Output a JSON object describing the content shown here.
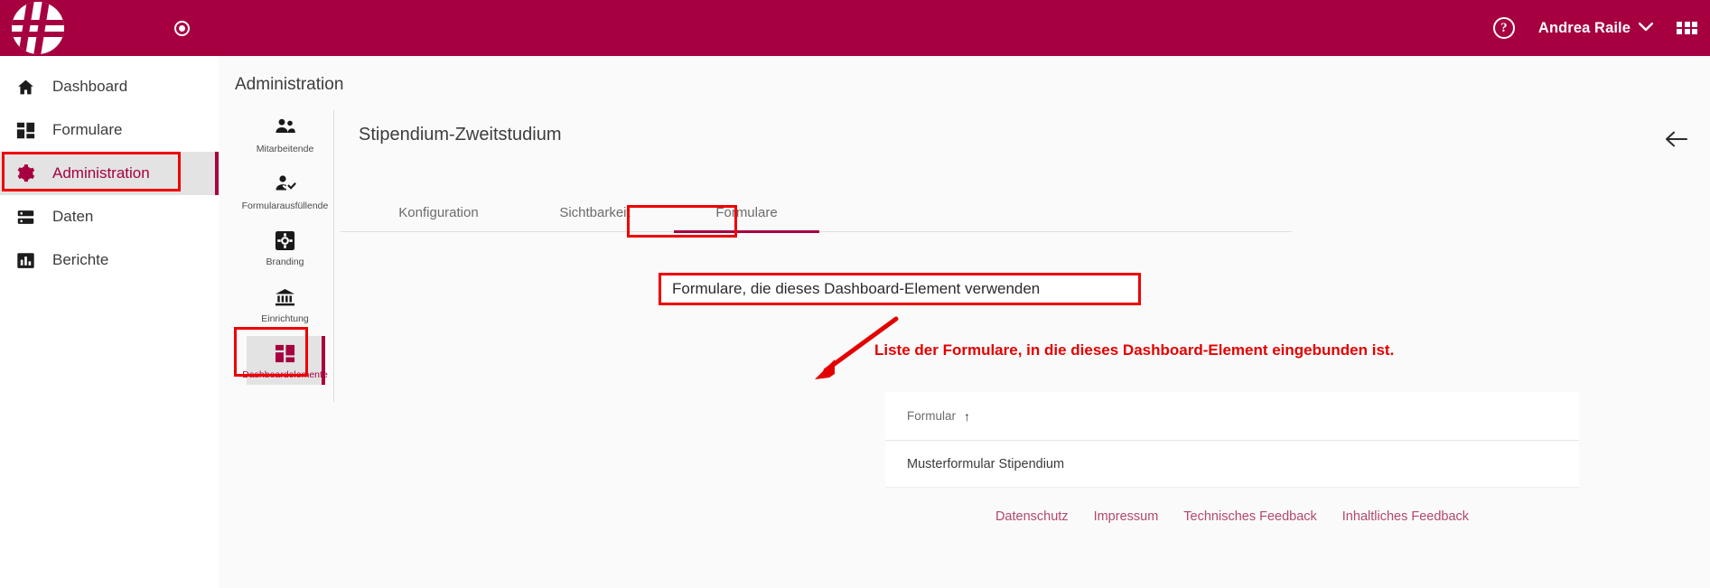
{
  "header": {
    "logo_icon": "hash-logo-icon",
    "record_icon": "record-dot-icon",
    "help_icon": "help-circle-icon",
    "help_glyph": "?",
    "user_name": "Andrea Raile",
    "user_chevron_icon": "chevron-down-icon",
    "apps_icon": "apps-grid-icon",
    "brand_color": "#a60040"
  },
  "sidebar": {
    "items": [
      {
        "label": "Dashboard",
        "icon": "home-icon",
        "active": false
      },
      {
        "label": "Formulare",
        "icon": "forms-grid-icon",
        "active": false
      },
      {
        "label": "Administration",
        "icon": "gear-icon",
        "active": true
      },
      {
        "label": "Daten",
        "icon": "database-icon",
        "active": false
      },
      {
        "label": "Berichte",
        "icon": "bar-chart-icon",
        "active": false
      }
    ]
  },
  "page": {
    "title": "Administration",
    "back_icon": "arrow-left-icon"
  },
  "rail": {
    "items": [
      {
        "label": "Mitarbeitende",
        "icon": "people-icon",
        "selected": false
      },
      {
        "label": "Formularausfüllende",
        "icon": "person-check-icon",
        "selected": false
      },
      {
        "label": "Branding",
        "icon": "branding-gear-icon",
        "selected": false
      },
      {
        "label": "Einrichtung",
        "icon": "institution-icon",
        "selected": false
      },
      {
        "label": "Dashboardelemente",
        "icon": "dashboard-tiles-icon",
        "selected": true
      }
    ]
  },
  "card": {
    "title": "Stipendium-Zweitstudium",
    "tabs": [
      {
        "label": "Konfiguration",
        "active": false,
        "highlighted": false
      },
      {
        "label": "Sichtbarkeit",
        "active": false,
        "highlighted": false
      },
      {
        "label": "Formulare",
        "active": true,
        "highlighted": true
      }
    ]
  },
  "annotations": {
    "box_label": "Formulare, die dieses Dashboard-Element verwenden",
    "red_note": "Liste der Formulare, in die dieses Dashboard-Element eingebunden ist.",
    "arrow_icon": "annotation-arrow-icon",
    "highlight_color": "#ef0000",
    "note_color": "#e30000"
  },
  "table": {
    "columns": [
      {
        "label": "Formular",
        "sort_icon": "sort-ascending-icon",
        "sort_glyph": "↑"
      }
    ],
    "rows": [
      {
        "formular": "Musterformular Stipendium"
      }
    ]
  },
  "footer": {
    "links": [
      {
        "label": "Datenschutz"
      },
      {
        "label": "Impressum"
      },
      {
        "label": "Technisches Feedback"
      },
      {
        "label": "Inhaltliches Feedback"
      }
    ]
  }
}
